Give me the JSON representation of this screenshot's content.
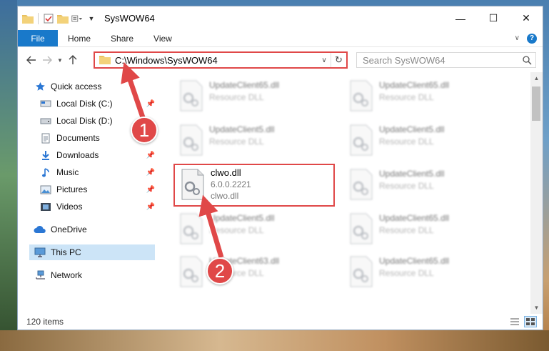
{
  "window": {
    "title": "SysWOW64",
    "controls": {
      "minimize": "—",
      "maximize": "☐",
      "close": "✕"
    }
  },
  "ribbon": {
    "tabs": [
      {
        "label": "File"
      },
      {
        "label": "Home"
      },
      {
        "label": "Share"
      },
      {
        "label": "View"
      }
    ],
    "help": "?"
  },
  "address": {
    "path": "C:\\Windows\\SysWOW64"
  },
  "search": {
    "placeholder": "Search SysWOW64"
  },
  "sidebar": {
    "quick_access": "Quick access",
    "items": [
      {
        "label": "Local Disk (C:)",
        "pinned": true
      },
      {
        "label": "Local Disk (D:)",
        "pinned": false
      },
      {
        "label": "Documents",
        "pinned": true
      },
      {
        "label": "Downloads",
        "pinned": true
      },
      {
        "label": "Music",
        "pinned": true
      },
      {
        "label": "Pictures",
        "pinned": true
      },
      {
        "label": "Videos",
        "pinned": true
      }
    ],
    "onedrive": "OneDrive",
    "this_pc": "This PC",
    "network": "Network",
    "selected": "This PC"
  },
  "files": [
    {
      "name": "UpdateClient65.dll",
      "type": "Resource DLL"
    },
    {
      "name": "UpdateClient65.dll",
      "type": "Resource DLL"
    },
    {
      "name": "UpdateClient5.dll",
      "type": "Resource DLL"
    },
    {
      "name": "UpdateClient5.dll",
      "type": "Resource DLL"
    },
    {
      "name": "clwo.dll",
      "version": "6.0.0.2221",
      "type": "clwo.dll"
    },
    {
      "name": "UpdateClient5.dll",
      "type": "Resource DLL"
    },
    {
      "name": "UpdateClient5.dll",
      "type": "Resource DLL"
    },
    {
      "name": "UpdateClient65.dll",
      "type": "Resource DLL"
    },
    {
      "name": "UpdateClient63.dll",
      "type": "Resource DLL"
    },
    {
      "name": "UpdateClient65.dll",
      "type": "Resource DLL"
    }
  ],
  "status": {
    "item_count": "120 items"
  },
  "annotations": {
    "step1": "1",
    "step2": "2"
  },
  "colors": {
    "accent": "#1979ca",
    "highlight": "#e04848",
    "selection": "#cce4f7"
  }
}
